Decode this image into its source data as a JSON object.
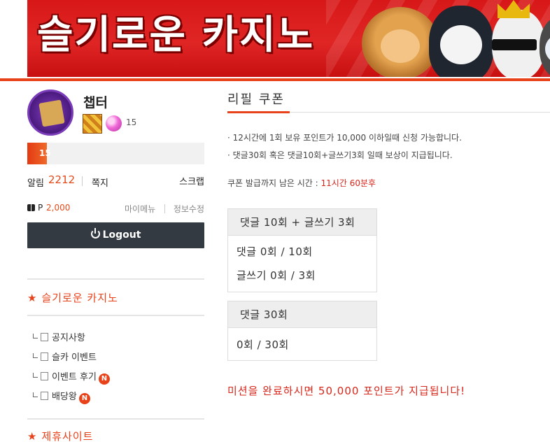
{
  "banner": {
    "title": "슬기로운 카지노"
  },
  "profile": {
    "username": "챕터",
    "level": "15",
    "xp_label": "15",
    "xp_fraction": 0.11,
    "alarm_label": "알림",
    "alarm_count": "2212",
    "memo_label": "쪽지",
    "scrap_label": "스크랩",
    "point_label": "P",
    "point_value": "2,000",
    "my_menu_label": "마이메뉴",
    "edit_info_label": "정보수정",
    "logout_label": "Logout"
  },
  "sidebar": {
    "section1_title": "슬기로운 카지노",
    "menu": [
      {
        "label": "공지사항",
        "badge": ""
      },
      {
        "label": "슬카 이벤트",
        "badge": ""
      },
      {
        "label": "이벤트 후기",
        "badge": "N"
      },
      {
        "label": "배당왕",
        "badge": "N"
      }
    ],
    "section2_title": "제휴사이트"
  },
  "main": {
    "title": "리필 쿠폰",
    "notices": [
      "· 12시간에 1회 보유 포인트가 10,000 이하일때 신청 가능합니다.",
      "· 댓글30회 혹은 댓글10회+글쓰기3회 일때 보상이 지급됩니다."
    ],
    "timer_label": "쿠폰 발급까지 남은 시간 : ",
    "timer_value": "11시간 60분후",
    "box1": {
      "title": "댓글 10회 + 글쓰기 3회",
      "rows": [
        "댓글 0회 / 10회",
        "글쓰기 0회 / 3회"
      ]
    },
    "box2": {
      "title": "댓글 30회",
      "rows": [
        "0회 / 30회"
      ]
    },
    "mission_text": "미션을 완료하시면 50,000 포인트가 지급됩니다!"
  },
  "colors": {
    "accent": "#e8421b",
    "banner_red": "#d81818",
    "logout_bg": "#343a42"
  }
}
